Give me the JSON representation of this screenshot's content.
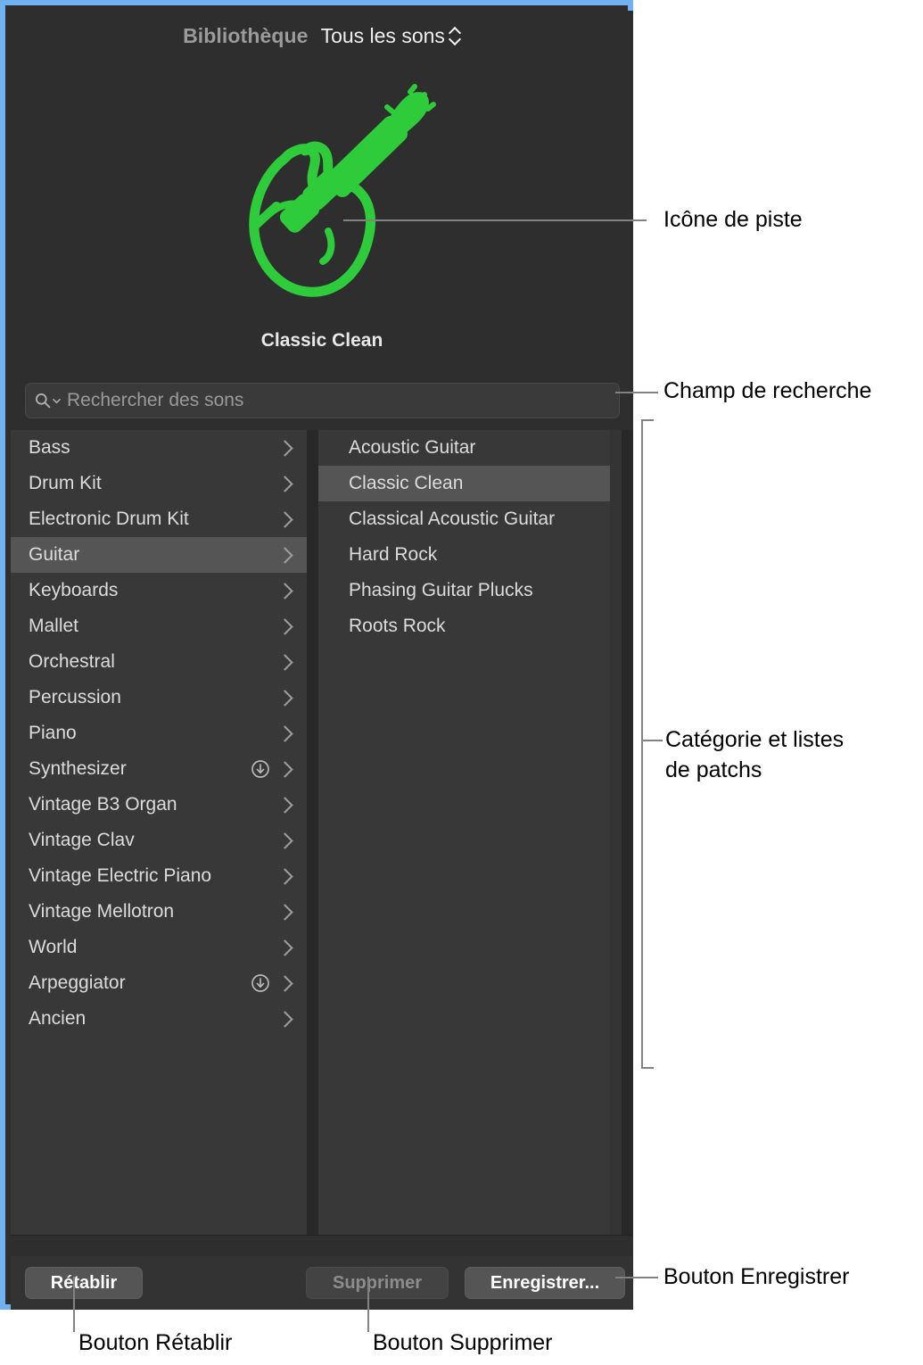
{
  "window": {
    "header": {
      "library_label": "Bibliothèque",
      "sound_menu_label": "Tous les sons",
      "sound_menu_icon": "chevron-up-down-icon"
    },
    "track_icon": {
      "name": "electric-guitar-icon",
      "color": "#2ecc3b"
    },
    "patch_name": "Classic Clean",
    "search": {
      "placeholder": "Rechercher des sons",
      "value": "",
      "icon": "search-icon",
      "menu_icon": "chevron-down-icon"
    },
    "categories": {
      "selected": "Guitar",
      "items": [
        {
          "label": "Bass",
          "download": false
        },
        {
          "label": "Drum Kit",
          "download": false
        },
        {
          "label": "Electronic Drum Kit",
          "download": false
        },
        {
          "label": "Guitar",
          "download": false
        },
        {
          "label": "Keyboards",
          "download": false
        },
        {
          "label": "Mallet",
          "download": false
        },
        {
          "label": "Orchestral",
          "download": false
        },
        {
          "label": "Percussion",
          "download": false
        },
        {
          "label": "Piano",
          "download": false
        },
        {
          "label": "Synthesizer",
          "download": true
        },
        {
          "label": "Vintage B3 Organ",
          "download": false
        },
        {
          "label": "Vintage Clav",
          "download": false
        },
        {
          "label": "Vintage Electric Piano",
          "download": false
        },
        {
          "label": "Vintage Mellotron",
          "download": false
        },
        {
          "label": "World",
          "download": false
        },
        {
          "label": "Arpeggiator",
          "download": true
        },
        {
          "label": "Ancien",
          "download": false
        }
      ]
    },
    "patches": {
      "selected": "Classic Clean",
      "items": [
        {
          "label": "Acoustic Guitar"
        },
        {
          "label": "Classic Clean"
        },
        {
          "label": "Classical Acoustic Guitar"
        },
        {
          "label": "Hard Rock"
        },
        {
          "label": "Phasing Guitar Plucks"
        },
        {
          "label": "Roots Rock"
        }
      ]
    },
    "footer": {
      "reset_label": "Rétablir",
      "delete_label": "Supprimer",
      "save_label": "Enregistrer..."
    },
    "colors": {
      "focus_border": "#72b1ef",
      "panel_bg": "#2e2e2e",
      "list_bg": "#383838",
      "selection": "#555555",
      "accent_green": "#2ecc3b"
    }
  },
  "annotations": {
    "track_icon": "Icône de piste",
    "search_field": "Champ de recherche",
    "category_patch_lists_line1": "Catégorie et listes",
    "category_patch_lists_line2": "de patchs",
    "save_button": "Bouton Enregistrer",
    "reset_button": "Bouton Rétablir",
    "delete_button": "Bouton Supprimer"
  }
}
